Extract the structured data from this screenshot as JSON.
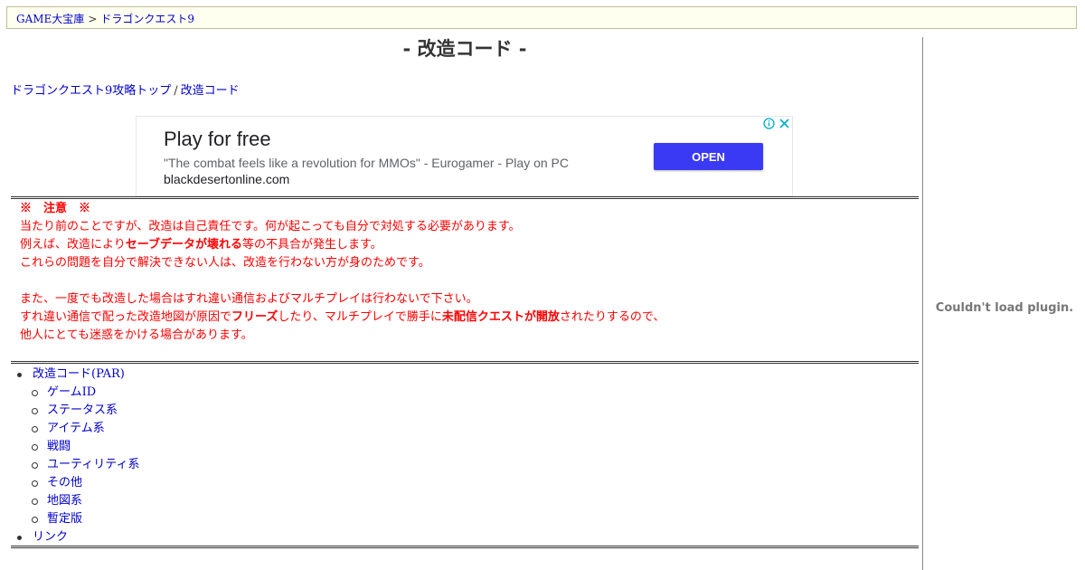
{
  "breadcrumb": {
    "items": [
      "GAME大宝庫",
      "ドラゴンクエスト9"
    ],
    "separator": ">"
  },
  "page": {
    "title": "- 改造コード -"
  },
  "nav_links": {
    "items": [
      "ドラゴンクエスト9攻略トップ",
      "改造コード"
    ],
    "separator": "/"
  },
  "ad": {
    "headline": "Play for free",
    "description": "\"The combat feels like a revolution for MMOs\" - Eurogamer - Play on PC",
    "domain": "blackdesertonline.com",
    "button_label": "OPEN",
    "info_icon": "info-icon",
    "close_icon": "close-icon",
    "accent_color": "#3a3af5"
  },
  "notice": {
    "title": "※　注意　※",
    "line1": "当たり前のことですが、改造は自己責任です。何が起こっても自分で対処する必要があります。",
    "line2_a": "例えば、改造により",
    "line2_b": "セーブデータが壊れる",
    "line2_c": "等の不具合が発生します。",
    "line3": "これらの問題を自分で解決できない人は、改造を行わない方が身のためです。",
    "line4": "また、一度でも改造した場合はすれ違い通信およびマルチプレイは行わないで下さい。",
    "line5_a": "すれ違い通信で配った改造地図が原因で",
    "line5_b": "フリーズ",
    "line5_c": "したり、マルチプレイで勝手に",
    "line5_d": "未配信クエストが開放",
    "line5_e": "されたりするので、",
    "line6": "他人にとても迷惑をかける場合があります。",
    "color": "#ff0000"
  },
  "toc": {
    "section1": "改造コード(PAR)",
    "sub": [
      "ゲームID",
      "ステータス系",
      "アイテム系",
      "戦闘",
      "ユーティリティ系",
      "その他",
      "地図系",
      "暫定版"
    ],
    "section2": "リンク"
  },
  "sidebar": {
    "plugin_message": "Couldn't load plugin."
  },
  "colors": {
    "link": "#0000cc",
    "breadcrumb_bg": "#fffff0"
  }
}
